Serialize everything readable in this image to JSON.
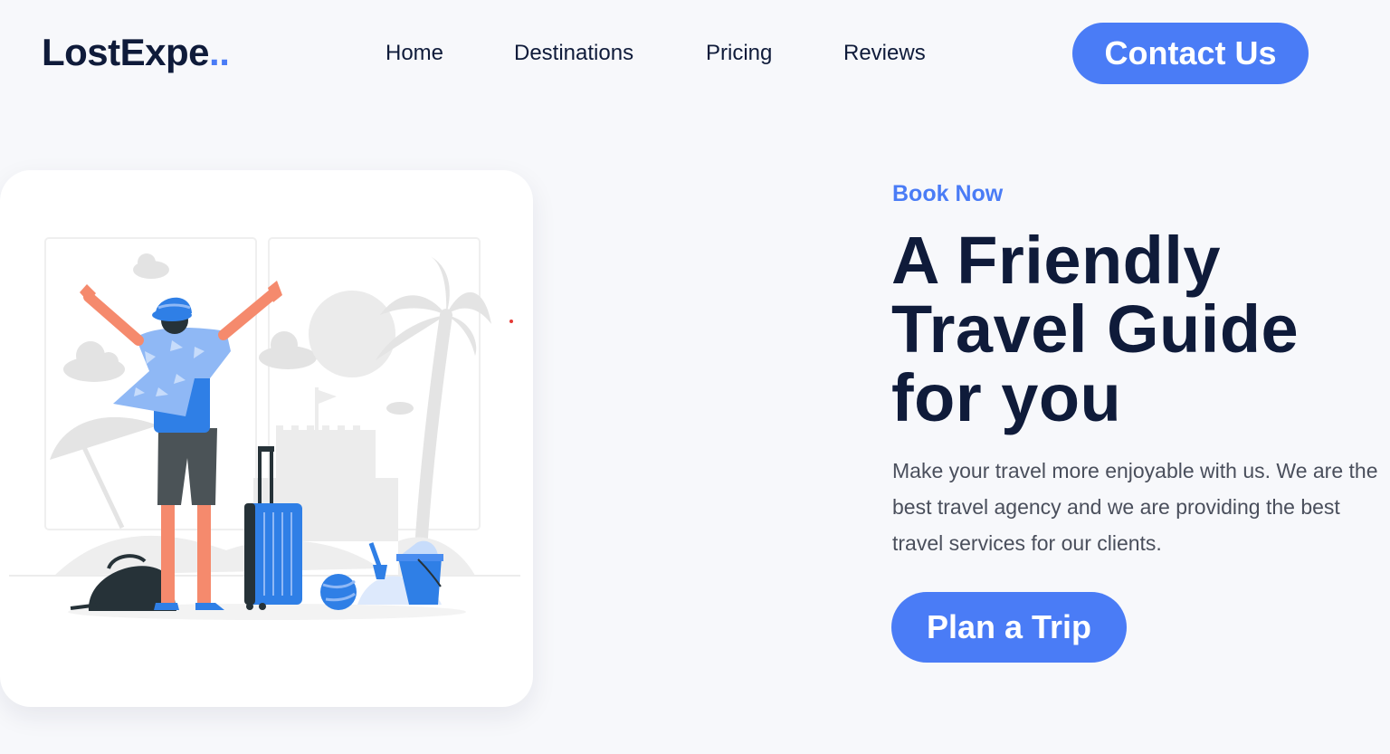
{
  "header": {
    "logo_text": "LostExpe",
    "logo_dots": "..",
    "nav": [
      "Home",
      "Destinations",
      "Pricing",
      "Reviews"
    ],
    "contact_label": "Contact Us"
  },
  "hero": {
    "eyebrow": "Book Now",
    "headline_lines": [
      "A Friendly",
      "Travel Guide",
      "for you"
    ],
    "description": "Make your travel more enjoyable with us. We are the best travel agency and we are providing the best travel services for our clients.",
    "cta_label": "Plan a Trip",
    "illustration_name": "traveler-beach-illustration"
  },
  "colors": {
    "accent": "#4a7cf6",
    "heading": "#0f1b3a",
    "body_text": "#4a4f5c",
    "background": "#f7f8fb",
    "card": "#ffffff"
  }
}
